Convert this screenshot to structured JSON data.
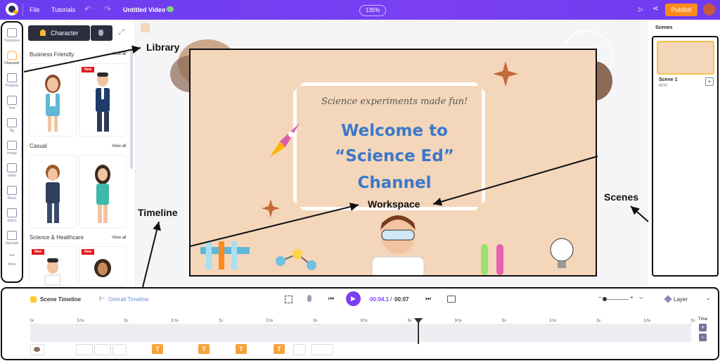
{
  "topbar": {
    "menu_file": "File",
    "menu_tutorials": "Tutorials",
    "doc_title": "Untitled Video",
    "zoom": "135%",
    "publish": "Publish",
    "brand_color": "#7b3ff2",
    "publish_color": "#ff8a1c"
  },
  "rail": {
    "items": [
      "Templates",
      "Character",
      "Property",
      "Text",
      "Bg",
      "Image",
      "Video",
      "Music",
      "Effect",
      "Uploads",
      "More"
    ]
  },
  "library": {
    "tab_character": "Character",
    "sections": [
      {
        "label": "Business Friendly",
        "view_all": "View all"
      },
      {
        "label": "Casual",
        "view_all": "View all"
      },
      {
        "label": "Science & Healthcare",
        "view_all": "View all"
      }
    ],
    "new_badge": "New"
  },
  "slide": {
    "subtitle": "Science experiments made fun!",
    "line1": "Welcome to",
    "line2": "“Science Ed”",
    "line3": "Channel"
  },
  "scenes": {
    "header": "Scenes",
    "scene_name": "Scene 1",
    "scene_duration": "00:07"
  },
  "timeline": {
    "scene_timeline": "Scene Timeline",
    "overall_timeline": "Overall Timeline",
    "current_time": "00:04.1",
    "separator": "/",
    "total_time": "00:07",
    "layer": "Layer",
    "time_label": "Time",
    "ticks": [
      "0s",
      "0.5s",
      "1s",
      "1.5s",
      "2s",
      "2.5s",
      "3s",
      "3.5s",
      "4s",
      "4.5s",
      "5s",
      "5.5s",
      "6s",
      "6.5s",
      "7s"
    ],
    "playhead_fraction": 0.5857
  },
  "annotations": {
    "library": "Library",
    "workspace": "Workspace",
    "timeline": "Timeline",
    "scenes": "Scenes"
  }
}
